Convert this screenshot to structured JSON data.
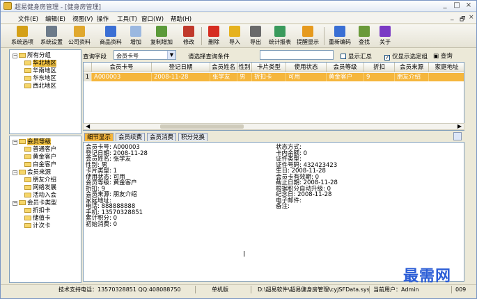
{
  "window": {
    "title": "超易健身房管理 - [健身房管理]",
    "controls": [
      "_",
      "□",
      "×"
    ],
    "child_controls": [
      "_",
      "🗗",
      "×"
    ]
  },
  "menu": [
    "文件(E)",
    "编辑(E)",
    "视图(V)",
    "操作",
    "工具(T)",
    "窗口(W)",
    "帮助(H)"
  ],
  "toolbar": [
    {
      "label": "系统选项",
      "color": "#d4a017"
    },
    {
      "label": "系统设置",
      "color": "#6d7b8a"
    },
    {
      "label": "公司资料",
      "color": "#e0a82e"
    },
    {
      "label": "商品资料",
      "color": "#3b6fd4"
    },
    {
      "label": "增加",
      "color": "#9bb8e0"
    },
    {
      "label": "复制增加",
      "color": "#5c9a3a"
    },
    {
      "label": "修改",
      "color": "#c0392b"
    },
    {
      "label": "删除",
      "color": "#d62d20"
    },
    {
      "label": "导入",
      "color": "#e6b21e"
    },
    {
      "label": "导出",
      "color": "#6a6a6a"
    },
    {
      "label": "统计报表",
      "color": "#3a9a5c"
    },
    {
      "label": "提醒显示",
      "color": "#e69a1e"
    },
    {
      "label": "重新编码",
      "color": "#3a6fd4"
    },
    {
      "label": "查找",
      "color": "#6a9a3a"
    },
    {
      "label": "关于",
      "color": "#7a3ac4"
    }
  ],
  "tree_top": {
    "root": "所有分组",
    "items": [
      "华北地区",
      "华南地区",
      "华东地区",
      "西北地区"
    ]
  },
  "tree_bottom": {
    "groups": [
      {
        "label": "会员等级",
        "items": [
          "普通客户",
          "黄金客户",
          "白金客户"
        ]
      },
      {
        "label": "会员来源",
        "items": [
          "朋友介绍",
          "网络发展",
          "活动入会"
        ]
      },
      {
        "label": "会员卡类型",
        "items": [
          "折扣卡",
          "储值卡",
          "计次卡"
        ]
      }
    ]
  },
  "filter": {
    "field_label": "查询字段",
    "field_value": "会员卡号",
    "cond_label": "请选择查询条件",
    "cond_value": "",
    "show_summary": "显示汇总",
    "show_selected": "仅显示选定组",
    "query_button": "查询"
  },
  "grid": {
    "columns": [
      "会员卡号",
      "登记日期",
      "会员姓名",
      "性别",
      "卡片类型",
      "使用状态",
      "会员等级",
      "折扣",
      "会员来源",
      "家庭地址"
    ],
    "rows": [
      {
        "num": "1",
        "cells": [
          "A000003",
          "2008-11-28",
          "张学友",
          "男",
          "折扣卡",
          "可用",
          "黄金客户",
          "9",
          "朋友介绍",
          ""
        ]
      }
    ]
  },
  "tabs": [
    "细节显示",
    "会员续费",
    "会员消费",
    "积分兑换"
  ],
  "detail_left": [
    "会员卡号: A000003",
    "登记日期: 2008-11-28",
    "会员姓名: 张学友",
    "性别: 男",
    "卡片类型: 1",
    "使用状态: 可用",
    "会员等级: 黄金客户",
    "折扣: 9",
    "会员来源: 朋友介绍",
    "家庭地址:",
    "电话: 888888888",
    "手机: 13570328851",
    "累计积分: 0",
    "初始消费: 0"
  ],
  "detail_right": [
    "状态方式:",
    "卡内余额: 0",
    "证件类型:",
    "证件号码: 432423423",
    "生日: 2008-11-28",
    "会员卡有效期: 0",
    "截止日期: 2008-11-28",
    "根据积分自动升级: 0",
    "纪念日: 2008-11-28",
    "电子邮件:",
    "备注:"
  ],
  "status": {
    "support": "技术支持电话：13570328851 QQ:408088750",
    "edition": "单机版",
    "path": "D:\\超易软件\\超易健身房管理\\cyJSFData.sys",
    "user": "当前用户：Admin",
    "year": "009"
  },
  "watermark": "最需网"
}
